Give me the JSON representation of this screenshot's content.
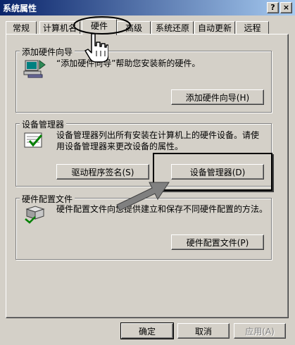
{
  "window": {
    "title": "系统属性",
    "help_button": "?",
    "close_button": "×"
  },
  "tabs": [
    "常规",
    "计算机名",
    "硬件",
    "高级",
    "系统还原",
    "自动更新",
    "远程"
  ],
  "add_hardware": {
    "group_title": "添加硬件向导",
    "description": "“添加硬件向导”帮助您安装新的硬件。",
    "button": "添加硬件向导(H)"
  },
  "device_manager": {
    "group_title": "设备管理器",
    "description_line1": "设备管理器列出所有安装在计算机上的硬件设备。请使",
    "description_line2": "用设备管理器来更改设备的属性。",
    "driver_signing_button": "驱动程序签名(S)",
    "device_manager_button": "设备管理器(D)"
  },
  "hardware_profiles": {
    "group_title": "硬件配置文件",
    "description": "硬件配置文件向您提供建立和保存不同硬件配置的方法。",
    "button": "硬件配置文件(P)"
  },
  "footer": {
    "ok": "确定",
    "cancel": "取消",
    "apply": "应用(A)"
  }
}
